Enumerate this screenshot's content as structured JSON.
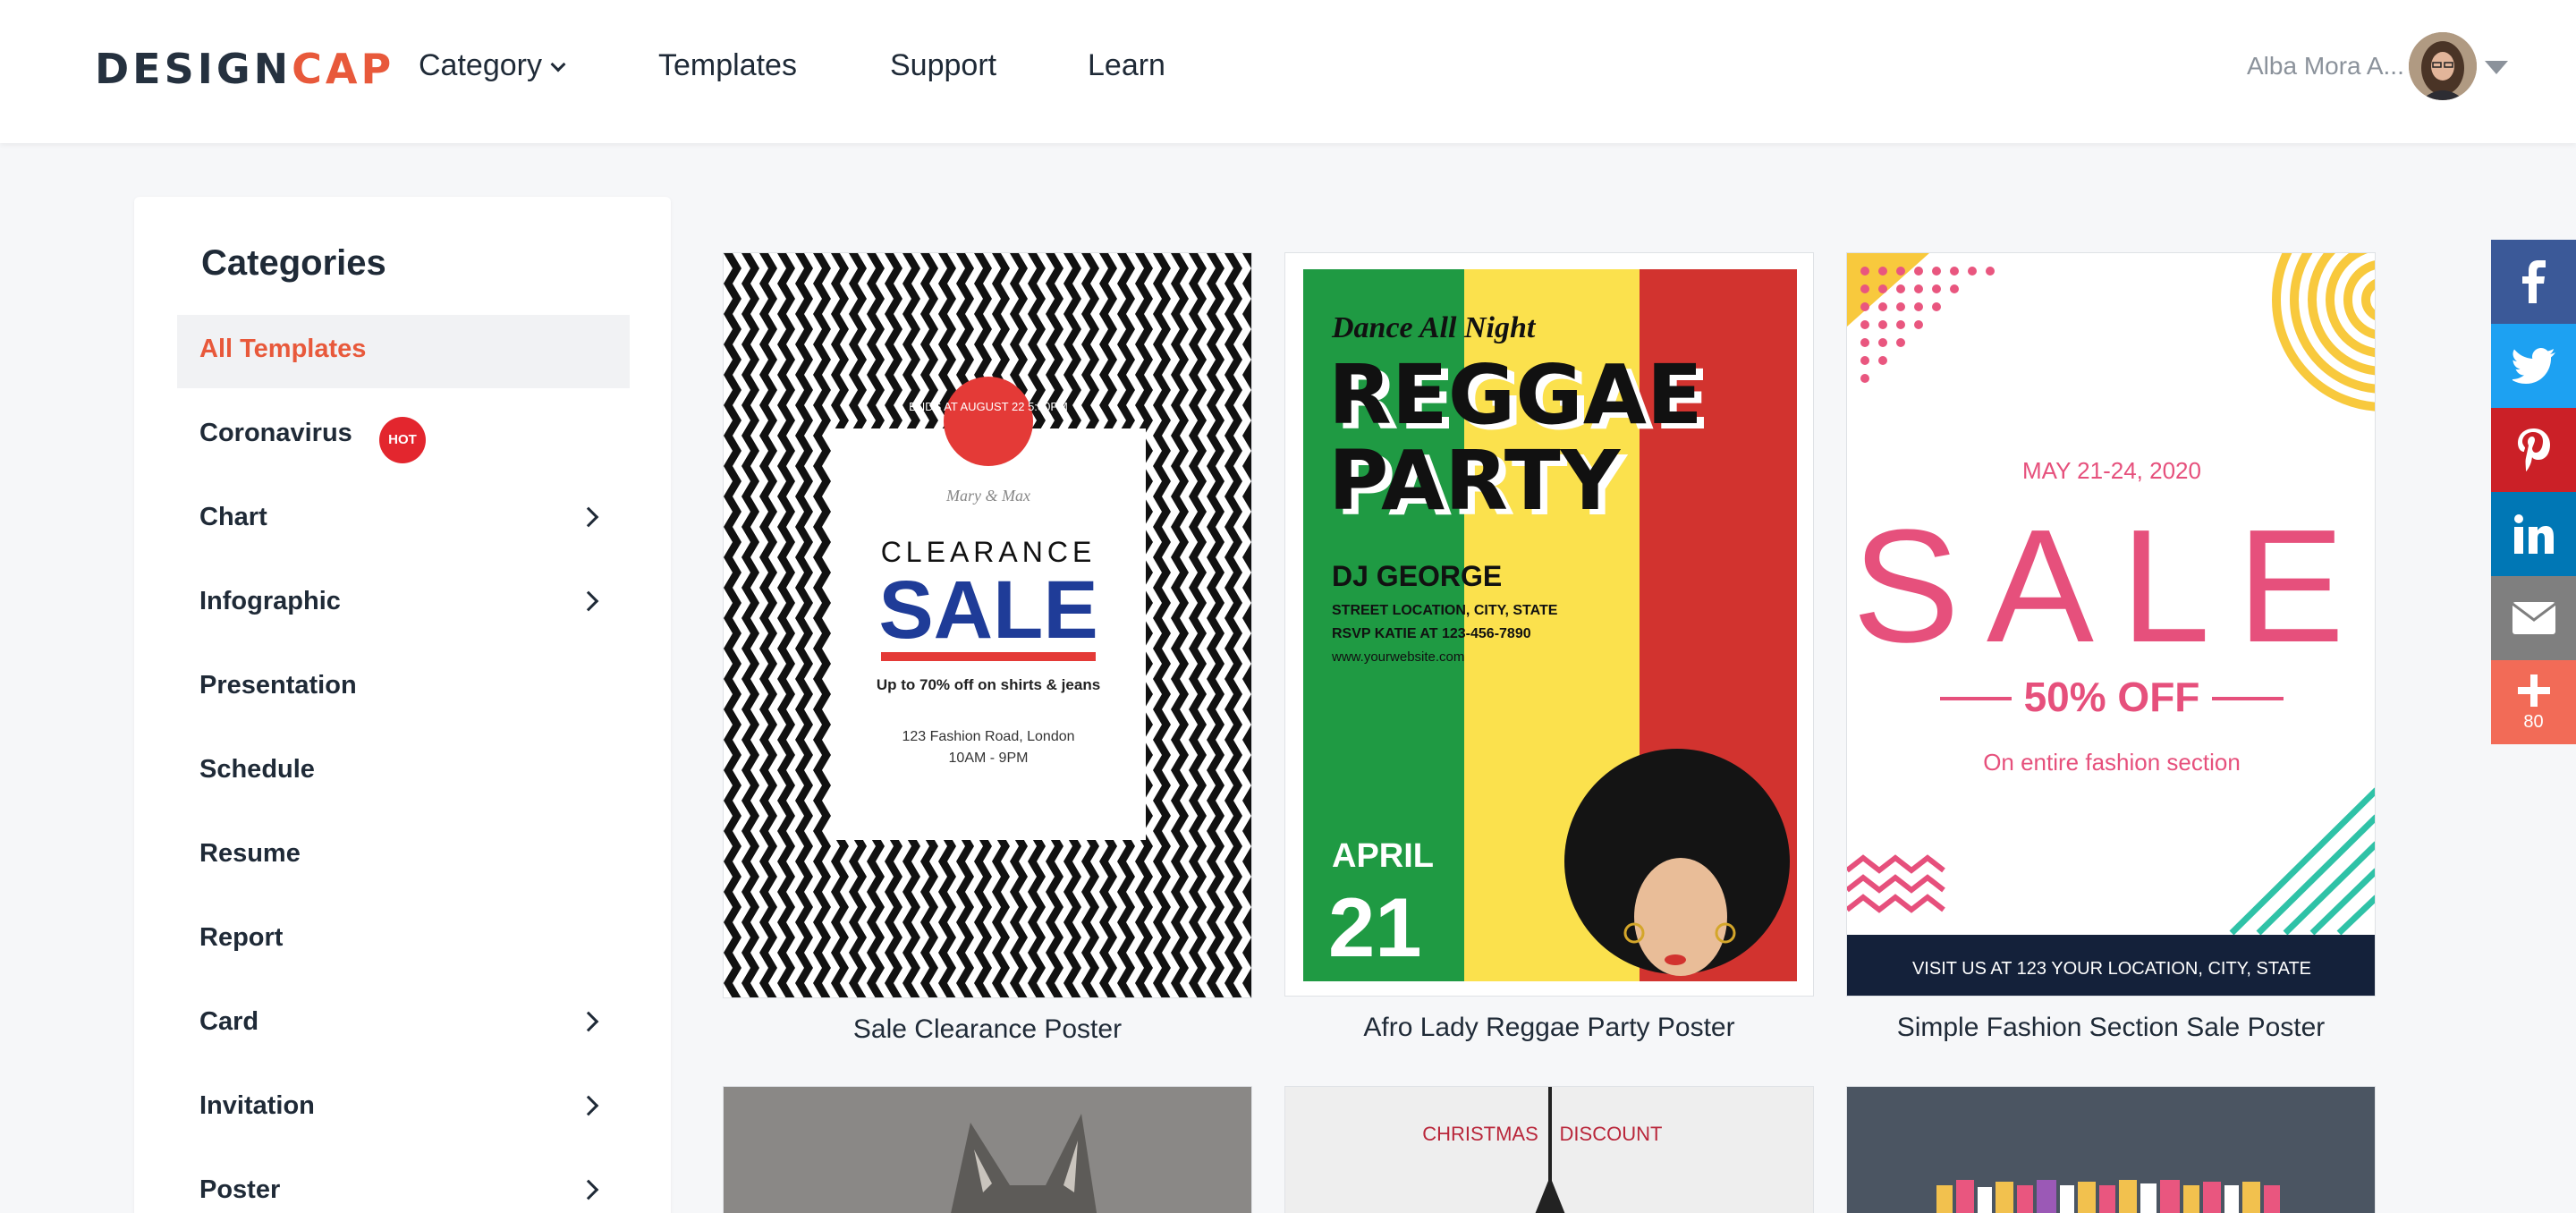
{
  "header": {
    "logo_part1": "DESIGN",
    "logo_part2": "CAP",
    "nav": {
      "category": "Category",
      "templates": "Templates",
      "support": "Support",
      "learn": "Learn"
    },
    "user_name": "Alba Mora A..."
  },
  "sidebar": {
    "title": "Categories",
    "items": [
      {
        "label": "All Templates",
        "active": true
      },
      {
        "label": "Coronavirus",
        "badge": "HOT"
      },
      {
        "label": "Chart",
        "has_submenu": true
      },
      {
        "label": "Infographic",
        "has_submenu": true
      },
      {
        "label": "Presentation"
      },
      {
        "label": "Schedule"
      },
      {
        "label": "Resume"
      },
      {
        "label": "Report"
      },
      {
        "label": "Card",
        "has_submenu": true
      },
      {
        "label": "Invitation",
        "has_submenu": true
      },
      {
        "label": "Poster",
        "has_submenu": true
      }
    ]
  },
  "templates": [
    {
      "caption": "Sale Clearance Poster",
      "poster": {
        "badge": "ENDS AT AUGUST 22 5:00PM",
        "names": "Mary & Max",
        "line1": "CLEARANCE",
        "line2": "SALE",
        "offer": "Up to 70% off on shirts & jeans",
        "address": "123 Fashion Road, London",
        "hours": "10AM - 9PM"
      }
    },
    {
      "caption": "Afro Lady Reggae Party Poster",
      "poster": {
        "tagline": "Dance All Night",
        "title1": "REGGAE",
        "title2": "PARTY",
        "dj": "DJ GEORGE",
        "street": "STREET LOCATION, CITY, STATE",
        "rsvp": "RSVP KATIE AT 123-456-7890",
        "website": "www.yourwebsite.com",
        "month": "APRIL",
        "day": "21"
      }
    },
    {
      "caption": "Simple Fashion Section Sale Poster",
      "poster": {
        "dates": "MAY 21-24, 2020",
        "sale": "SALE",
        "discount": "50% OFF",
        "subtitle": "On entire fashion section",
        "footer": "VISIT US AT 123 YOUR LOCATION, CITY, STATE"
      }
    },
    {
      "poster": {}
    },
    {
      "poster": {
        "word1": "CHRISTMAS",
        "word2": "DISCOUNT"
      }
    },
    {
      "poster": {}
    }
  ],
  "social": {
    "share_count": "80"
  },
  "colors": {
    "accent": "#e8593b",
    "facebook": "#3b5998",
    "twitter": "#1da1f2",
    "pinterest": "#cb2027",
    "linkedin": "#0077b5",
    "email": "#7f7f7f",
    "more": "#f26b57"
  }
}
